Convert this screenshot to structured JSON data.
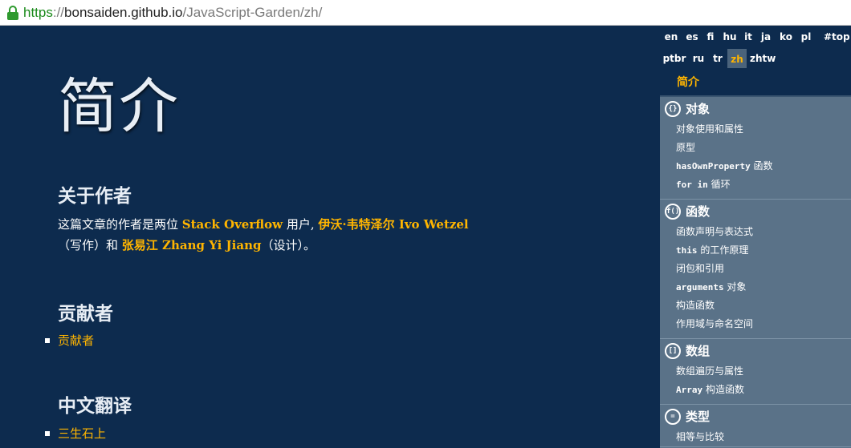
{
  "browser": {
    "url_scheme": "https",
    "url_sep": "://",
    "url_host": "bonsaiden.github.io",
    "url_path": "/JavaScript-Garden/zh/"
  },
  "main": {
    "title": "简介",
    "author_heading": "关于作者",
    "author_text": {
      "p1": "这篇文章的作者是两位 ",
      "link1": "Stack Overflow",
      "p2": " 用户, ",
      "link2": "伊沃·韦特泽尔 Ivo Wetzel",
      "p3": "（写作）和 ",
      "link3": "张易江 Zhang Yi Jiang",
      "p4": "（设计）。"
    },
    "contributors_heading": "贡献者",
    "contributors_link": "贡献者",
    "translation_heading": "中文翻译",
    "translation_link": "三生石上"
  },
  "nav": {
    "languages": [
      "en",
      "es",
      "fi",
      "hu",
      "it",
      "ja",
      "ko",
      "pl",
      "#top",
      "ptbr",
      "ru",
      "tr",
      "zh",
      "zhtw"
    ],
    "active_language": "zh",
    "intro": "简介",
    "sections": [
      {
        "icon": "{}",
        "title": "对象",
        "items": [
          {
            "code": "",
            "text": "对象使用和属性"
          },
          {
            "code": "",
            "text": "原型"
          },
          {
            "code": "hasOwnProperty",
            "text": " 函数"
          },
          {
            "code": "for in",
            "text": " 循环"
          }
        ]
      },
      {
        "icon": "f()",
        "title": "函数",
        "items": [
          {
            "code": "",
            "text": "函数声明与表达式"
          },
          {
            "code": "this",
            "text": " 的工作原理"
          },
          {
            "code": "",
            "text": "闭包和引用"
          },
          {
            "code": "arguments",
            "text": " 对象"
          },
          {
            "code": "",
            "text": "构造函数"
          },
          {
            "code": "",
            "text": "作用域与命名空间"
          }
        ]
      },
      {
        "icon": "[]",
        "title": "数组",
        "items": [
          {
            "code": "",
            "text": "数组遍历与属性"
          },
          {
            "code": "Array",
            "text": " 构造函数"
          }
        ]
      },
      {
        "icon": "=",
        "title": "类型",
        "items": [
          {
            "code": "",
            "text": "相等与比较"
          }
        ]
      }
    ]
  },
  "colors": {
    "background": "#0d2b4e",
    "link": "#ffb500",
    "sidebar": "#5a7288"
  }
}
